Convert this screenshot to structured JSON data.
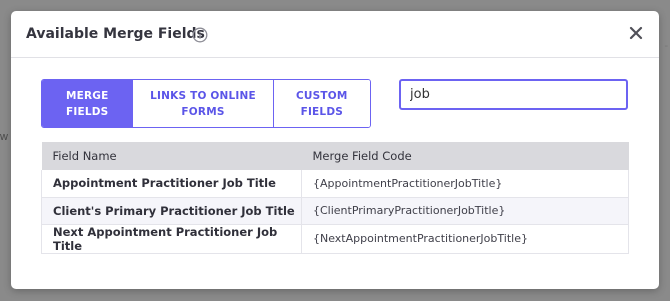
{
  "backdrop": {
    "left_glimpse": "w",
    "right_glimpse": "-"
  },
  "modal": {
    "title": "Available Merge Fields",
    "info_icon": "info-circle-icon",
    "close_icon": "close-x-icon"
  },
  "tabs": [
    {
      "label": "MERGE FIELDS",
      "active": true
    },
    {
      "label": "LINKS TO ONLINE FORMS",
      "active": false
    },
    {
      "label": "CUSTOM FIELDS",
      "active": false
    }
  ],
  "search": {
    "value": "job",
    "placeholder": ""
  },
  "table": {
    "headers": [
      "Field Name",
      "Merge Field Code"
    ],
    "rows": [
      {
        "name": "Appointment Practitioner Job Title",
        "code": "{AppointmentPractitionerJobTitle}"
      },
      {
        "name": "Client's Primary Practitioner Job Title",
        "code": "{ClientPrimaryPractitionerJobTitle}"
      },
      {
        "name": "Next Appointment Practitioner Job Title",
        "code": "{NextAppointmentPractitionerJobTitle}"
      }
    ]
  },
  "colors": {
    "accent": "#6c63f2",
    "header_bg": "#d9d9dd",
    "overlay": "#8a8a8a"
  }
}
